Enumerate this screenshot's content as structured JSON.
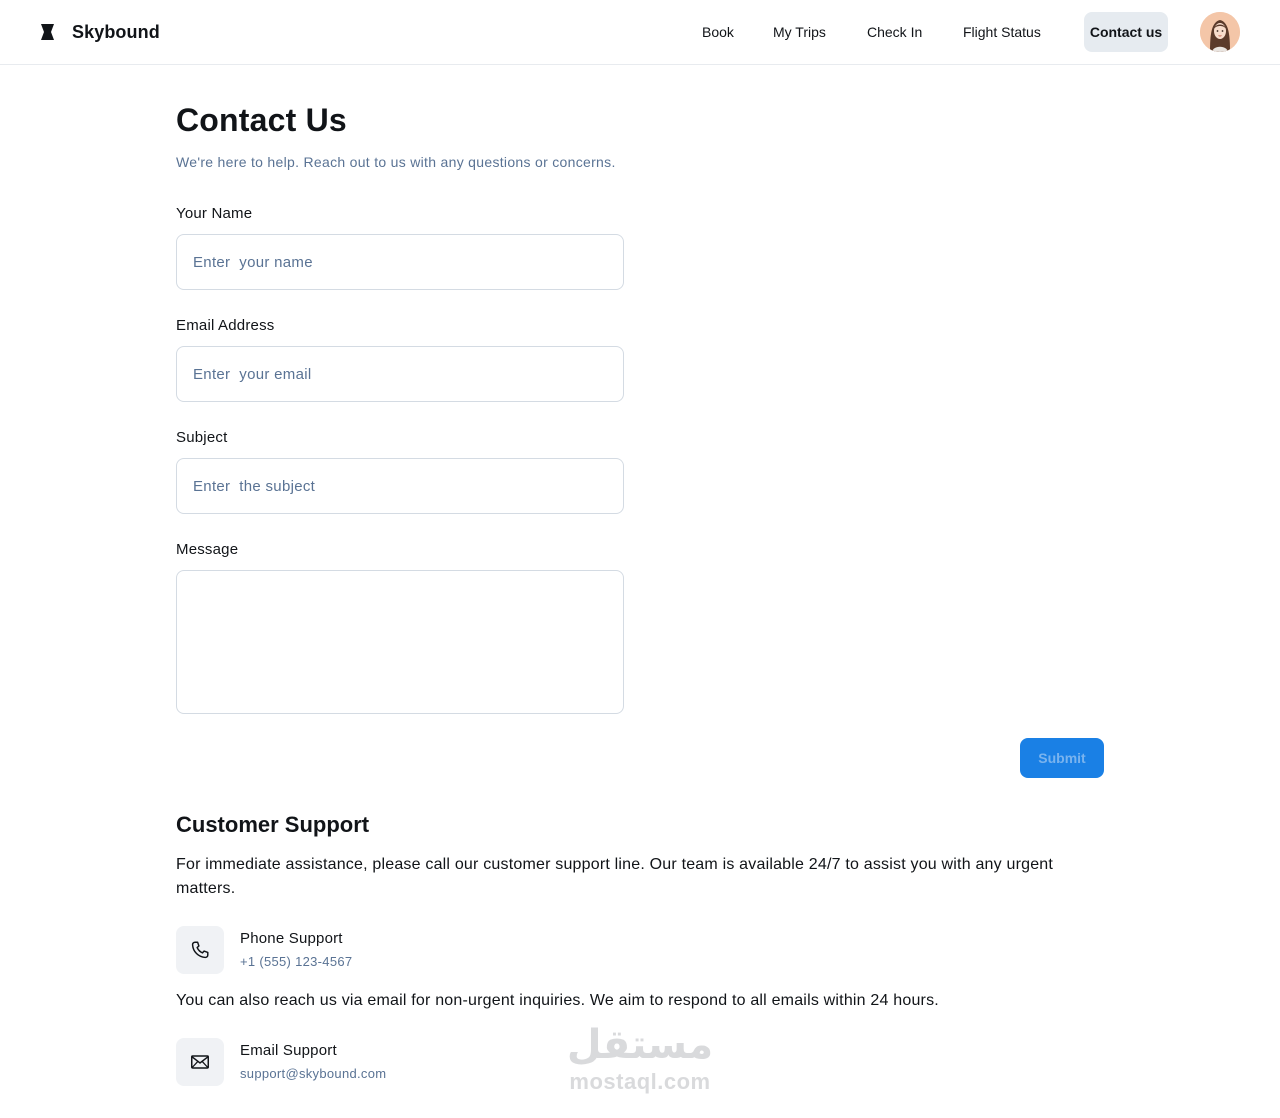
{
  "header": {
    "brand": "Skybound",
    "nav": [
      {
        "label": "Book"
      },
      {
        "label": "My Trips"
      },
      {
        "label": "Check In"
      },
      {
        "label": "Flight Status"
      },
      {
        "label": "Contact us",
        "active": true
      }
    ]
  },
  "main": {
    "title": "Contact Us",
    "subtitle": "We're here to help. Reach out to us with any questions or concerns.",
    "form": {
      "name": {
        "label": "Your Name",
        "placeholder": "Enter  your name",
        "value": ""
      },
      "email": {
        "label": "Email Address",
        "placeholder": "Enter  your email",
        "value": ""
      },
      "subject": {
        "label": "Subject",
        "placeholder": "Enter  the subject",
        "value": ""
      },
      "message": {
        "label": "Message",
        "placeholder": "",
        "value": ""
      },
      "submit_label": "Submit"
    },
    "support": {
      "title": "Customer Support",
      "phone_intro": "For immediate assistance, please call our customer support line. Our team is available 24/7 to assist you with any urgent matters.",
      "phone": {
        "title": "Phone Support",
        "value": "+1 (555) 123-4567",
        "icon": "phone-icon"
      },
      "email_intro": "You can also reach us via email for non-urgent inquiries. We aim to respond to all emails within 24 hours.",
      "email": {
        "title": "Email Support",
        "value": "support@skybound.com",
        "icon": "mail-icon"
      }
    }
  },
  "watermark": {
    "arabic": "مستقل",
    "latin": "mostaql.com"
  },
  "colors": {
    "accent": "#1a80e5",
    "muted_text": "#5a7394",
    "border": "#d4dbe3",
    "chip_bg": "#f0f2f5"
  }
}
